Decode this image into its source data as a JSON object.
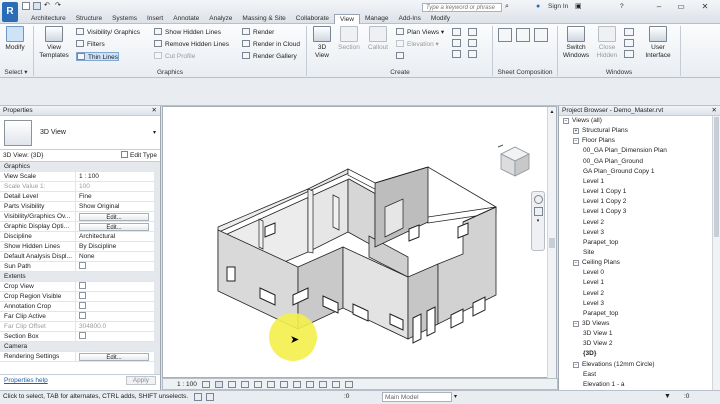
{
  "quick_access": {
    "app_button": "R"
  },
  "tabs": [
    "Architecture",
    "Structure",
    "Systems",
    "Insert",
    "Annotate",
    "Analyze",
    "Massing & Site",
    "Collaborate",
    "View",
    "Manage",
    "Add-Ins",
    "Modify"
  ],
  "active_tab": "View",
  "search": {
    "placeholder": "Type a keyword or phrase"
  },
  "sign_in": "Sign In",
  "ribbon": {
    "select_panel": {
      "modify": "Modify",
      "title": "Select ▾"
    },
    "graphics": {
      "view_templates": "View Templates",
      "visibility_graphics": "Visibility/ Graphics",
      "filters": "Filters",
      "thin_lines": "Thin Lines",
      "show_hidden_lines": "Show Hidden Lines",
      "remove_hidden_lines": "Remove Hidden Lines",
      "cut_profile": "Cut Profile",
      "render": "Render",
      "render_cloud": "Render in Cloud",
      "render_gallery": "Render Gallery",
      "title": "Graphics"
    },
    "create": {
      "view_3d": "3D View",
      "section": "Section",
      "callout": "Callout",
      "plan_views": "Plan Views",
      "elevation": "Elevation",
      "title": "Create"
    },
    "sheet": {
      "title": "Sheet Composition"
    },
    "windows": {
      "switch_windows": "Switch Windows",
      "close_hidden": "Close Hidden",
      "user_interface": "User Interface",
      "title": "Windows"
    }
  },
  "properties": {
    "title": "Properties",
    "type_name": "3D View",
    "instance_selector": "3D View: {3D}",
    "edit_type": "Edit Type",
    "rows": [
      {
        "k": "Graphics",
        "v": "",
        "section": true
      },
      {
        "k": "View Scale",
        "v": "1 : 100"
      },
      {
        "k": "Scale Value    1:",
        "v": "100",
        "dim": true
      },
      {
        "k": "Detail Level",
        "v": "Fine"
      },
      {
        "k": "Parts Visibility",
        "v": "Show Original"
      },
      {
        "k": "Visibility/Graphics Ov...",
        "v": "Edit...",
        "button": true
      },
      {
        "k": "Graphic Display Opti...",
        "v": "Edit...",
        "button": true
      },
      {
        "k": "Discipline",
        "v": "Architectural"
      },
      {
        "k": "Show Hidden Lines",
        "v": "By Discipline"
      },
      {
        "k": "Default Analysis Displ...",
        "v": "None"
      },
      {
        "k": "Sun Path",
        "v": "",
        "check": true
      },
      {
        "k": "Extents",
        "v": "",
        "section": true
      },
      {
        "k": "Crop View",
        "v": "",
        "check": true
      },
      {
        "k": "Crop Region Visible",
        "v": "",
        "check": true
      },
      {
        "k": "Annotation Crop",
        "v": "",
        "check": true
      },
      {
        "k": "Far Clip Active",
        "v": "",
        "check": true
      },
      {
        "k": "Far Clip Offset",
        "v": "304800.0",
        "dim": true
      },
      {
        "k": "Section Box",
        "v": "",
        "check": true
      },
      {
        "k": "Camera",
        "v": "",
        "section": true
      },
      {
        "k": "Rendering Settings",
        "v": "Edit...",
        "button": true
      }
    ],
    "help_link": "Properties help",
    "apply": "Apply"
  },
  "viewport": {
    "scale": "1 : 100"
  },
  "project_browser": {
    "title": "Project Browser - Demo_Master.rvt",
    "items": [
      {
        "label": "Views (all)",
        "level": 0,
        "toggle": "−"
      },
      {
        "label": "Structural Plans",
        "level": 1,
        "toggle": "+"
      },
      {
        "label": "Floor Plans",
        "level": 1,
        "toggle": "−"
      },
      {
        "label": "00_GA Plan_Dimension Plan",
        "level": 2
      },
      {
        "label": "00_GA Plan_Ground",
        "level": 2
      },
      {
        "label": "GA Plan_Ground Copy 1",
        "level": 2
      },
      {
        "label": "Level 1",
        "level": 2
      },
      {
        "label": "Level 1 Copy 1",
        "level": 2
      },
      {
        "label": "Level 1 Copy 2",
        "level": 2
      },
      {
        "label": "Level 1 Copy 3",
        "level": 2
      },
      {
        "label": "Level 2",
        "level": 2
      },
      {
        "label": "Level 3",
        "level": 2
      },
      {
        "label": "Parapet_top",
        "level": 2
      },
      {
        "label": "Site",
        "level": 2
      },
      {
        "label": "Ceiling Plans",
        "level": 1,
        "toggle": "−"
      },
      {
        "label": "Level 0",
        "level": 2
      },
      {
        "label": "Level 1",
        "level": 2
      },
      {
        "label": "Level 2",
        "level": 2
      },
      {
        "label": "Level 3",
        "level": 2
      },
      {
        "label": "Parapet_top",
        "level": 2
      },
      {
        "label": "3D Views",
        "level": 1,
        "toggle": "−"
      },
      {
        "label": "3D View 1",
        "level": 2
      },
      {
        "label": "3D View 2",
        "level": 2
      },
      {
        "label": "{3D}",
        "level": 2,
        "bold": true
      },
      {
        "label": "Elevations (12mm Circle)",
        "level": 1,
        "toggle": "−"
      },
      {
        "label": "East",
        "level": 2
      },
      {
        "label": "Elevation 1 - a",
        "level": 2
      }
    ]
  },
  "status": {
    "message": "Click to select, TAB for alternates, CTRL adds, SHIFT unselects.",
    "model": "Main Model",
    "zero": ":0"
  }
}
